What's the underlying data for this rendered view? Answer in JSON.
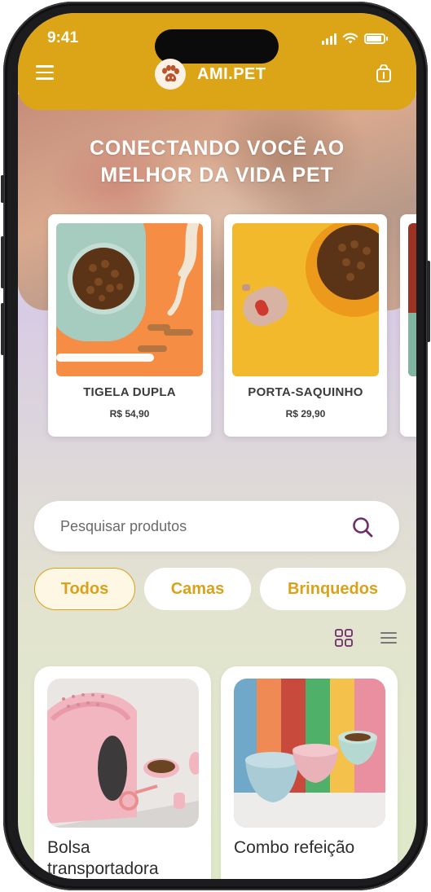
{
  "status_bar": {
    "time": "9:41"
  },
  "header": {
    "brand": "AMI.PET",
    "menu_icon": "menu-icon",
    "bag_icon": "shopping-bag-icon",
    "accent_color": "#dca417"
  },
  "hero": {
    "title_line1": "CONECTANDO VOCÊ AO",
    "title_line2": "MELHOR DA VIDA PET"
  },
  "featured": [
    {
      "name": "TIGELA DUPLA",
      "price": "R$ 54,90"
    },
    {
      "name": "PORTA-SAQUINHO",
      "price": "R$ 29,90"
    }
  ],
  "search": {
    "placeholder": "Pesquisar produtos"
  },
  "categories": [
    {
      "label": "Todos",
      "active": true
    },
    {
      "label": "Camas",
      "active": false
    },
    {
      "label": "Brinquedos",
      "active": false
    }
  ],
  "products": [
    {
      "name": "Bolsa transportadora"
    },
    {
      "name": "Combo refeição"
    }
  ]
}
